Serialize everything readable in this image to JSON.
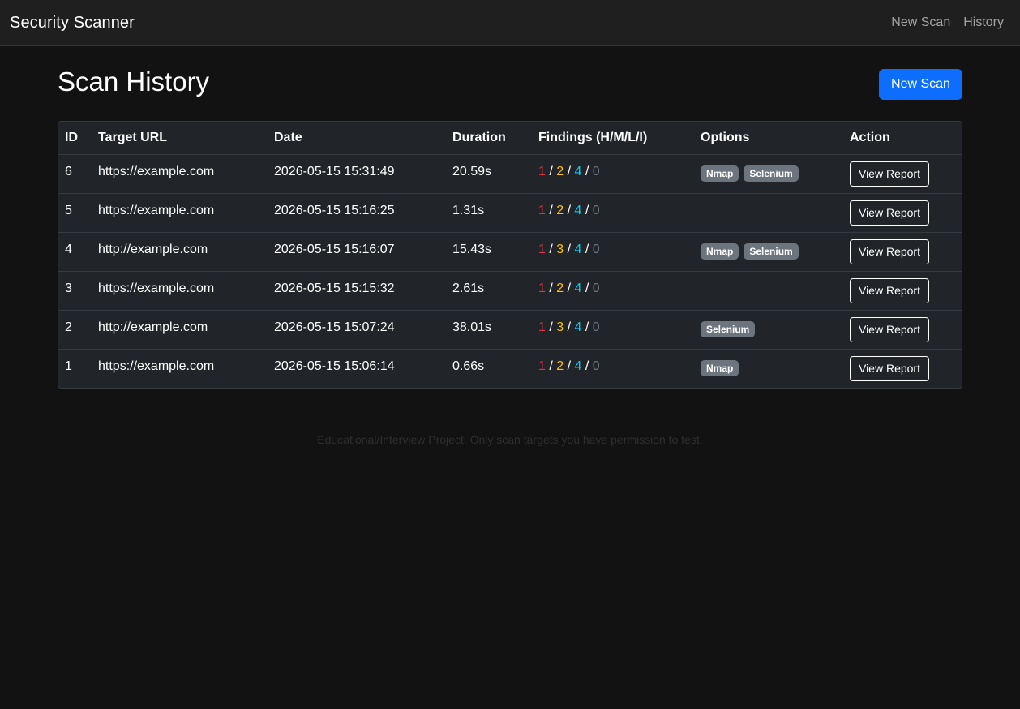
{
  "navbar": {
    "brand": "Security Scanner",
    "links": [
      "New Scan",
      "History"
    ]
  },
  "page": {
    "title": "Scan History",
    "new_scan_label": "New Scan"
  },
  "table": {
    "headers": [
      "ID",
      "Target URL",
      "Date",
      "Duration",
      "Findings (H/M/L/I)",
      "Options",
      "Action"
    ],
    "rows": [
      {
        "id": "6",
        "url": "https://example.com",
        "date": "2026-05-15 15:31:49",
        "duration": "20.59s",
        "findings": {
          "h": "1",
          "m": "2",
          "l": "4",
          "i": "0"
        },
        "options": [
          "Nmap",
          "Selenium"
        ],
        "action": "View Report"
      },
      {
        "id": "5",
        "url": "https://example.com",
        "date": "2026-05-15 15:16:25",
        "duration": "1.31s",
        "findings": {
          "h": "1",
          "m": "2",
          "l": "4",
          "i": "0"
        },
        "options": [],
        "action": "View Report"
      },
      {
        "id": "4",
        "url": "http://example.com",
        "date": "2026-05-15 15:16:07",
        "duration": "15.43s",
        "findings": {
          "h": "1",
          "m": "3",
          "l": "4",
          "i": "0"
        },
        "options": [
          "Nmap",
          "Selenium"
        ],
        "action": "View Report"
      },
      {
        "id": "3",
        "url": "https://example.com",
        "date": "2026-05-15 15:15:32",
        "duration": "2.61s",
        "findings": {
          "h": "1",
          "m": "2",
          "l": "4",
          "i": "0"
        },
        "options": [],
        "action": "View Report"
      },
      {
        "id": "2",
        "url": "http://example.com",
        "date": "2026-05-15 15:07:24",
        "duration": "38.01s",
        "findings": {
          "h": "1",
          "m": "3",
          "l": "4",
          "i": "0"
        },
        "options": [
          "Selenium"
        ],
        "action": "View Report"
      },
      {
        "id": "1",
        "url": "https://example.com",
        "date": "2026-05-15 15:06:14",
        "duration": "0.66s",
        "findings": {
          "h": "1",
          "m": "2",
          "l": "4",
          "i": "0"
        },
        "options": [
          "Nmap"
        ],
        "action": "View Report"
      }
    ]
  },
  "footer": {
    "text": "Educational/Interview Project. Only scan targets you have permission to test."
  },
  "colors": {
    "background": "#121212",
    "navbar": "#1f1f1f",
    "primary": "#0d6efd",
    "high": "#dc3545",
    "medium": "#ffc107",
    "low": "#0dcaf0",
    "info": "#6c757d"
  }
}
